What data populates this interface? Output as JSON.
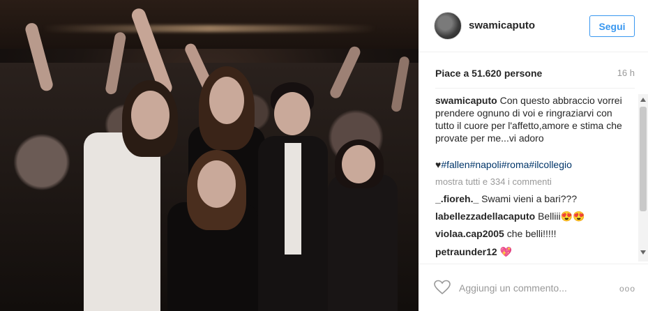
{
  "header": {
    "username": "swamicaputo",
    "follow_label": "Segui"
  },
  "post": {
    "likes": "Piace a 51.620 persone",
    "time": "16 h",
    "caption_user": "swamicaputo",
    "caption_text": "Con questo abbraccio vorrei prendere ognuno di voi e ringraziarvi con tutto il cuore per l'affetto,amore e stima che provate per me...vi adoro",
    "heart_glyph": "♥",
    "hashtags": [
      "#fallen",
      "#napoli",
      "#roma",
      "#ilcollegio"
    ],
    "show_all": "mostra tutti e 334 i commenti"
  },
  "comments": [
    {
      "user": "_.fioreh._",
      "text": "Swami vieni a bari???"
    },
    {
      "user": "labellezzadellacaputo",
      "text": "Belliii😍😍"
    },
    {
      "user": "violaa.cap2005",
      "text": "che belli!!!!!"
    },
    {
      "user": "petraunder12",
      "text": "💖"
    }
  ],
  "footer": {
    "add_comment_placeholder": "Aggiungi un commento...",
    "more_glyph": "ooo"
  },
  "colors": {
    "accent": "#3897f0",
    "hashtag": "#003569",
    "muted": "#999999"
  },
  "icons": [
    "heart-icon",
    "more-options-icon",
    "scroll-up-icon",
    "scroll-down-icon"
  ]
}
